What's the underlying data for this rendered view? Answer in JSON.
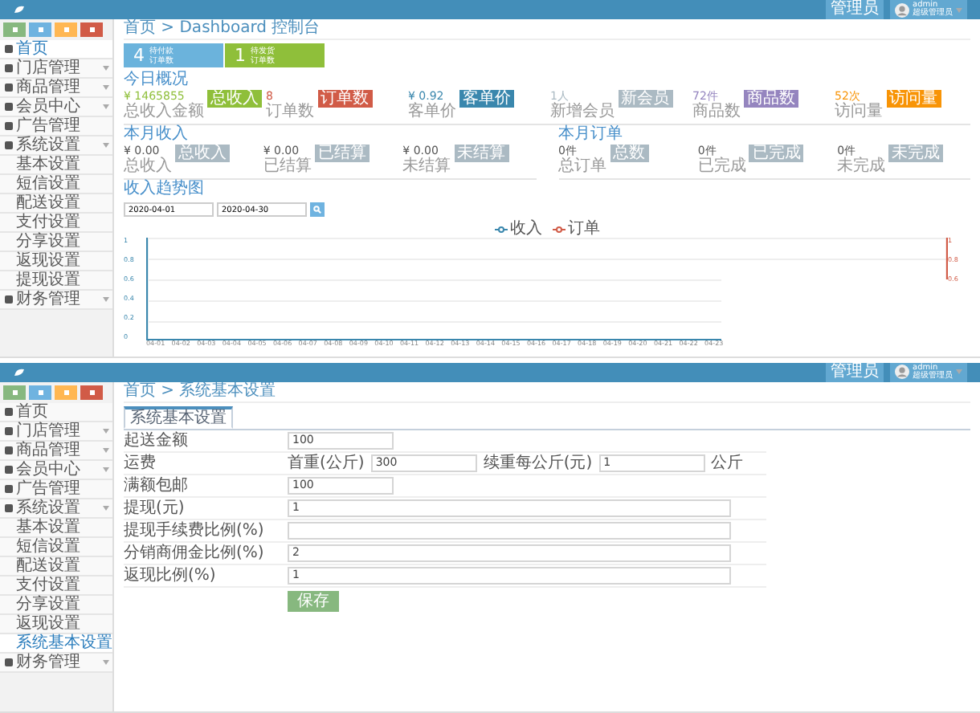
{
  "screens": [
    {
      "header": {
        "menu": "管理员",
        "user": "admin",
        "role": "超级管理员"
      },
      "sidebar": {
        "items": [
          {
            "label": "首页",
            "selected": true
          },
          {
            "label": "门店管理",
            "expandable": true
          },
          {
            "label": "商品管理",
            "expandable": true
          },
          {
            "label": "会员中心",
            "expandable": true
          },
          {
            "label": "广告管理"
          },
          {
            "label": "系统设置",
            "expandable": true,
            "children": [
              {
                "label": "基本设置",
                "selected": false
              },
              {
                "label": "短信设置",
                "selected": false
              },
              {
                "label": "配送设置",
                "selected": false
              },
              {
                "label": "支付设置",
                "selected": false
              },
              {
                "label": "分享设置",
                "selected": false
              },
              {
                "label": "返现设置",
                "selected": false
              },
              {
                "label": "提现设置",
                "selected": false
              }
            ]
          },
          {
            "label": "财务管理",
            "expandable": true
          }
        ]
      },
      "breadcrumb": "首页 > Dashboard 控制台",
      "kind": "dashboard",
      "tiles": [
        {
          "count": "4",
          "label": "待付款",
          "sub": "订单数",
          "color": "#6bb3dc"
        },
        {
          "count": "1",
          "label": "待发货",
          "sub": "订单数",
          "color": "#8fbf3a"
        }
      ],
      "today": {
        "title": "今日概况",
        "stats": [
          {
            "value": "¥ 1465855",
            "sub": "总收入金额",
            "tag": "总收入",
            "color": "#8fbf3a"
          },
          {
            "value": "8",
            "sub": "订单数",
            "tag": "订单数",
            "color": "#d15b47"
          },
          {
            "value": "¥ 0.92",
            "sub": "客单价",
            "tag": "客单价",
            "color": "#3a87ad"
          },
          {
            "value": "1人",
            "sub": "新增会员",
            "tag": "新会员",
            "color": "#abbac3"
          },
          {
            "value": "72件",
            "sub": "商品数",
            "tag": "商品数",
            "color": "#9585bf"
          },
          {
            "value": "52次",
            "sub": "访问量",
            "tag": "访问量",
            "color": "#f89406"
          }
        ]
      },
      "income": {
        "title": "本月收入",
        "stats": [
          {
            "value": "¥ 0.00",
            "sub": "总收入",
            "tag": "总收入"
          },
          {
            "value": "¥ 0.00",
            "sub": "已结算",
            "tag": "已结算"
          },
          {
            "value": "¥ 0.00",
            "sub": "未结算",
            "tag": "未结算"
          }
        ]
      },
      "orders": {
        "title": "本月订单",
        "stats": [
          {
            "value": "0件",
            "sub": "总订单",
            "tag": "总数"
          },
          {
            "value": "0件",
            "sub": "已完成",
            "tag": "已完成"
          },
          {
            "value": "0件",
            "sub": "未完成",
            "tag": "未完成"
          }
        ]
      },
      "trend": {
        "title": "收入趋势图",
        "from": "2020-04-01",
        "to": "2020-04-30",
        "legend": [
          {
            "label": "收入",
            "color": "#3a87ad"
          },
          {
            "label": "订单",
            "color": "#d15b47"
          }
        ],
        "left_ticks": [
          "1",
          "0.8",
          "0.6",
          "0.4",
          "0.2",
          "0"
        ],
        "right_ticks": [
          "1",
          "0.8",
          "0.6"
        ],
        "x_labels": [
          "04-01",
          "04-02",
          "04-03",
          "04-04",
          "04-05",
          "04-06",
          "04-07",
          "04-08",
          "04-09",
          "04-10",
          "04-11",
          "04-12",
          "04-13",
          "04-14",
          "04-15",
          "04-16",
          "04-17",
          "04-18",
          "04-19",
          "04-20",
          "04-21",
          "04-22",
          "04-23"
        ]
      }
    },
    {
      "header": {
        "menu": "管理员",
        "user": "admin",
        "role": "超级管理员"
      },
      "sidebar": {
        "items": [
          {
            "label": "首页",
            "selected": false
          },
          {
            "label": "门店管理",
            "expandable": true
          },
          {
            "label": "商品管理",
            "expandable": true
          },
          {
            "label": "会员中心",
            "expandable": true
          },
          {
            "label": "广告管理"
          },
          {
            "label": "系统设置",
            "expandable": true,
            "children": [
              {
                "label": "基本设置",
                "selected": false
              },
              {
                "label": "短信设置",
                "selected": false
              },
              {
                "label": "配送设置",
                "selected": false
              },
              {
                "label": "支付设置",
                "selected": false
              },
              {
                "label": "分享设置",
                "selected": false
              },
              {
                "label": "返现设置",
                "selected": false
              },
              {
                "label": "系统基本设置",
                "selected": true
              }
            ]
          },
          {
            "label": "财务管理",
            "expandable": true
          }
        ]
      },
      "breadcrumb": "首页 > 系统基本设置",
      "kind": "form",
      "tabs": [
        {
          "label": "系统基本设置",
          "selected": true
        }
      ],
      "form": {
        "rows": [
          {
            "label": "起送金额",
            "fields": [
              {
                "kind": "input",
                "value": "100"
              }
            ]
          },
          {
            "label": "运费",
            "fields": [
              {
                "kind": "text",
                "text": "首重(公斤)"
              },
              {
                "kind": "input",
                "value": "300"
              },
              {
                "kind": "text",
                "text": "续重每公斤(元)"
              },
              {
                "kind": "input",
                "value": "1"
              },
              {
                "kind": "text",
                "text": "公斤"
              }
            ]
          },
          {
            "label": "满额包邮",
            "fields": [
              {
                "kind": "input",
                "value": "100"
              }
            ]
          },
          {
            "label": "提现(元)",
            "fields": [
              {
                "kind": "input",
                "value": "1"
              }
            ],
            "wide": true
          },
          {
            "label": "提现手续费比例(%)",
            "fields": [
              {
                "kind": "input"
              }
            ],
            "wide": true
          },
          {
            "label": "分销商佣金比例(%)",
            "fields": [
              {
                "kind": "input",
                "value": "2"
              }
            ],
            "wide": true
          },
          {
            "label": "返现比例(%)",
            "fields": [
              {
                "kind": "input",
                "value": "1"
              }
            ],
            "wide": true
          }
        ],
        "submit": "保存"
      }
    }
  ]
}
